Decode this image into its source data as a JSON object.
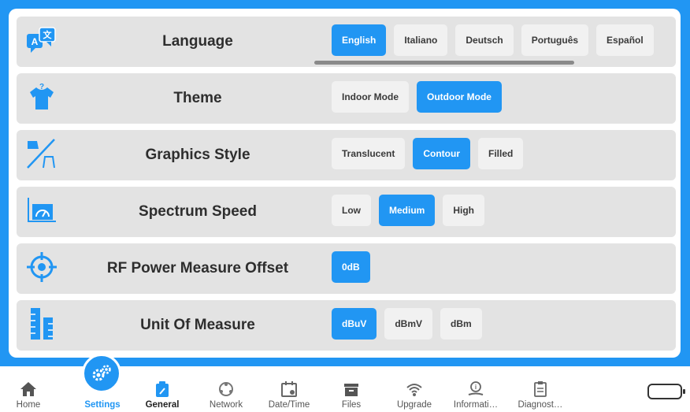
{
  "settings": [
    {
      "key": "language",
      "icon": "translate-icon",
      "label": "Language",
      "options": [
        "English",
        "Italiano",
        "Deutsch",
        "Português",
        "Español"
      ],
      "selected": "English"
    },
    {
      "key": "theme",
      "icon": "shirt-icon",
      "label": "Theme",
      "options": [
        "Indoor Mode",
        "Outdoor Mode"
      ],
      "selected": "Outdoor Mode"
    },
    {
      "key": "graphics-style",
      "icon": "graphics-style-icon",
      "label": "Graphics Style",
      "options": [
        "Translucent",
        "Contour",
        "Filled"
      ],
      "selected": "Contour"
    },
    {
      "key": "spectrum-speed",
      "icon": "spectrum-speed-icon",
      "label": "Spectrum Speed",
      "options": [
        "Low",
        "Medium",
        "High"
      ],
      "selected": "Medium"
    },
    {
      "key": "rf-power-offset",
      "icon": "crosshair-icon",
      "label": "RF Power Measure Offset",
      "options": [
        "0dB"
      ],
      "selected": "0dB"
    },
    {
      "key": "unit-of-measure",
      "icon": "ruler-icon",
      "label": "Unit Of Measure",
      "options": [
        "dBuV",
        "dBmV",
        "dBm"
      ],
      "selected": "dBuV"
    }
  ],
  "nav": [
    {
      "key": "home",
      "label": "Home",
      "icon": "home-icon"
    },
    {
      "key": "settings",
      "label": "Settings",
      "icon": "gears-icon"
    },
    {
      "key": "general",
      "label": "General",
      "icon": "general-icon"
    },
    {
      "key": "network",
      "label": "Network",
      "icon": "network-icon"
    },
    {
      "key": "datetime",
      "label": "Date/Time",
      "icon": "calendar-icon"
    },
    {
      "key": "files",
      "label": "Files",
      "icon": "files-icon"
    },
    {
      "key": "upgrade",
      "label": "Upgrade",
      "icon": "wifi-upgrade-icon"
    },
    {
      "key": "information",
      "label": "Informati…",
      "icon": "info-hand-icon"
    },
    {
      "key": "diagnostics",
      "label": "Diagnost…",
      "icon": "clipboard-icon"
    }
  ],
  "colors": {
    "accent": "#2196f3",
    "row_bg": "#e3e3e3",
    "option_bg": "#f1f1f1"
  }
}
